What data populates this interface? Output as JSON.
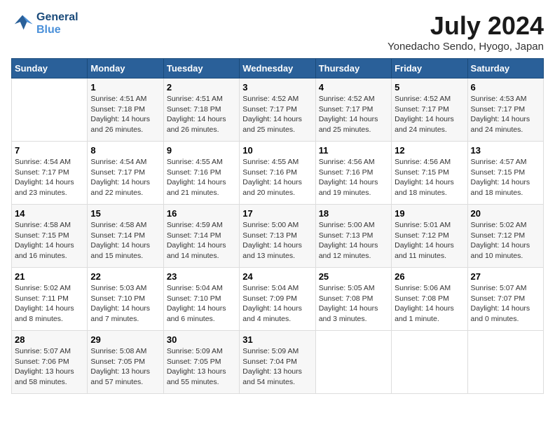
{
  "header": {
    "logo_line1": "General",
    "logo_line2": "Blue",
    "month_year": "July 2024",
    "location": "Yonedacho Sendo, Hyogo, Japan"
  },
  "weekdays": [
    "Sunday",
    "Monday",
    "Tuesday",
    "Wednesday",
    "Thursday",
    "Friday",
    "Saturday"
  ],
  "rows": [
    [
      {
        "day": "",
        "info": ""
      },
      {
        "day": "1",
        "info": "Sunrise: 4:51 AM\nSunset: 7:18 PM\nDaylight: 14 hours\nand 26 minutes."
      },
      {
        "day": "2",
        "info": "Sunrise: 4:51 AM\nSunset: 7:18 PM\nDaylight: 14 hours\nand 26 minutes."
      },
      {
        "day": "3",
        "info": "Sunrise: 4:52 AM\nSunset: 7:17 PM\nDaylight: 14 hours\nand 25 minutes."
      },
      {
        "day": "4",
        "info": "Sunrise: 4:52 AM\nSunset: 7:17 PM\nDaylight: 14 hours\nand 25 minutes."
      },
      {
        "day": "5",
        "info": "Sunrise: 4:52 AM\nSunset: 7:17 PM\nDaylight: 14 hours\nand 24 minutes."
      },
      {
        "day": "6",
        "info": "Sunrise: 4:53 AM\nSunset: 7:17 PM\nDaylight: 14 hours\nand 24 minutes."
      }
    ],
    [
      {
        "day": "7",
        "info": "Sunrise: 4:54 AM\nSunset: 7:17 PM\nDaylight: 14 hours\nand 23 minutes."
      },
      {
        "day": "8",
        "info": "Sunrise: 4:54 AM\nSunset: 7:17 PM\nDaylight: 14 hours\nand 22 minutes."
      },
      {
        "day": "9",
        "info": "Sunrise: 4:55 AM\nSunset: 7:16 PM\nDaylight: 14 hours\nand 21 minutes."
      },
      {
        "day": "10",
        "info": "Sunrise: 4:55 AM\nSunset: 7:16 PM\nDaylight: 14 hours\nand 20 minutes."
      },
      {
        "day": "11",
        "info": "Sunrise: 4:56 AM\nSunset: 7:16 PM\nDaylight: 14 hours\nand 19 minutes."
      },
      {
        "day": "12",
        "info": "Sunrise: 4:56 AM\nSunset: 7:15 PM\nDaylight: 14 hours\nand 18 minutes."
      },
      {
        "day": "13",
        "info": "Sunrise: 4:57 AM\nSunset: 7:15 PM\nDaylight: 14 hours\nand 18 minutes."
      }
    ],
    [
      {
        "day": "14",
        "info": "Sunrise: 4:58 AM\nSunset: 7:15 PM\nDaylight: 14 hours\nand 16 minutes."
      },
      {
        "day": "15",
        "info": "Sunrise: 4:58 AM\nSunset: 7:14 PM\nDaylight: 14 hours\nand 15 minutes."
      },
      {
        "day": "16",
        "info": "Sunrise: 4:59 AM\nSunset: 7:14 PM\nDaylight: 14 hours\nand 14 minutes."
      },
      {
        "day": "17",
        "info": "Sunrise: 5:00 AM\nSunset: 7:13 PM\nDaylight: 14 hours\nand 13 minutes."
      },
      {
        "day": "18",
        "info": "Sunrise: 5:00 AM\nSunset: 7:13 PM\nDaylight: 14 hours\nand 12 minutes."
      },
      {
        "day": "19",
        "info": "Sunrise: 5:01 AM\nSunset: 7:12 PM\nDaylight: 14 hours\nand 11 minutes."
      },
      {
        "day": "20",
        "info": "Sunrise: 5:02 AM\nSunset: 7:12 PM\nDaylight: 14 hours\nand 10 minutes."
      }
    ],
    [
      {
        "day": "21",
        "info": "Sunrise: 5:02 AM\nSunset: 7:11 PM\nDaylight: 14 hours\nand 8 minutes."
      },
      {
        "day": "22",
        "info": "Sunrise: 5:03 AM\nSunset: 7:10 PM\nDaylight: 14 hours\nand 7 minutes."
      },
      {
        "day": "23",
        "info": "Sunrise: 5:04 AM\nSunset: 7:10 PM\nDaylight: 14 hours\nand 6 minutes."
      },
      {
        "day": "24",
        "info": "Sunrise: 5:04 AM\nSunset: 7:09 PM\nDaylight: 14 hours\nand 4 minutes."
      },
      {
        "day": "25",
        "info": "Sunrise: 5:05 AM\nSunset: 7:08 PM\nDaylight: 14 hours\nand 3 minutes."
      },
      {
        "day": "26",
        "info": "Sunrise: 5:06 AM\nSunset: 7:08 PM\nDaylight: 14 hours\nand 1 minute."
      },
      {
        "day": "27",
        "info": "Sunrise: 5:07 AM\nSunset: 7:07 PM\nDaylight: 14 hours\nand 0 minutes."
      }
    ],
    [
      {
        "day": "28",
        "info": "Sunrise: 5:07 AM\nSunset: 7:06 PM\nDaylight: 13 hours\nand 58 minutes."
      },
      {
        "day": "29",
        "info": "Sunrise: 5:08 AM\nSunset: 7:05 PM\nDaylight: 13 hours\nand 57 minutes."
      },
      {
        "day": "30",
        "info": "Sunrise: 5:09 AM\nSunset: 7:05 PM\nDaylight: 13 hours\nand 55 minutes."
      },
      {
        "day": "31",
        "info": "Sunrise: 5:09 AM\nSunset: 7:04 PM\nDaylight: 13 hours\nand 54 minutes."
      },
      {
        "day": "",
        "info": ""
      },
      {
        "day": "",
        "info": ""
      },
      {
        "day": "",
        "info": ""
      }
    ]
  ]
}
